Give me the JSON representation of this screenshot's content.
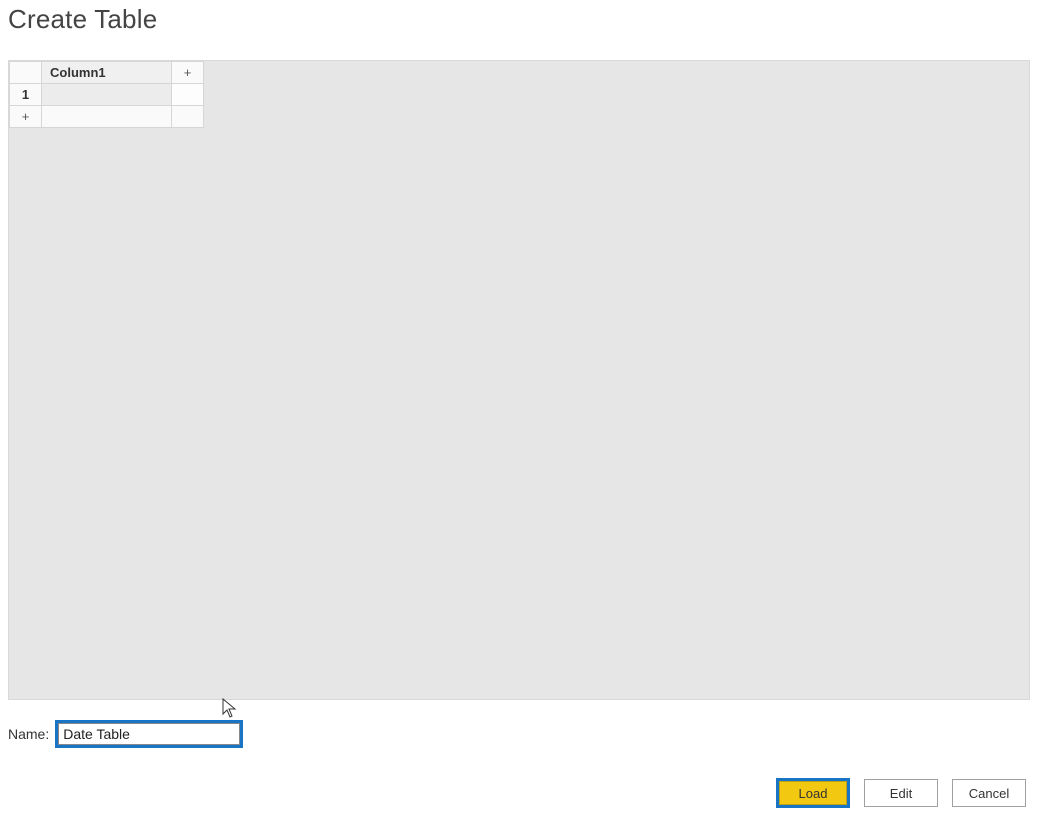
{
  "title": "Create Table",
  "table": {
    "column_header": "Column1",
    "add_column_glyph": "+",
    "row_number": "1",
    "cell_value": "",
    "add_row_glyph": "+"
  },
  "name_field": {
    "label": "Name:",
    "value": "Date Table"
  },
  "buttons": {
    "load": "Load",
    "edit": "Edit",
    "cancel": "Cancel"
  }
}
